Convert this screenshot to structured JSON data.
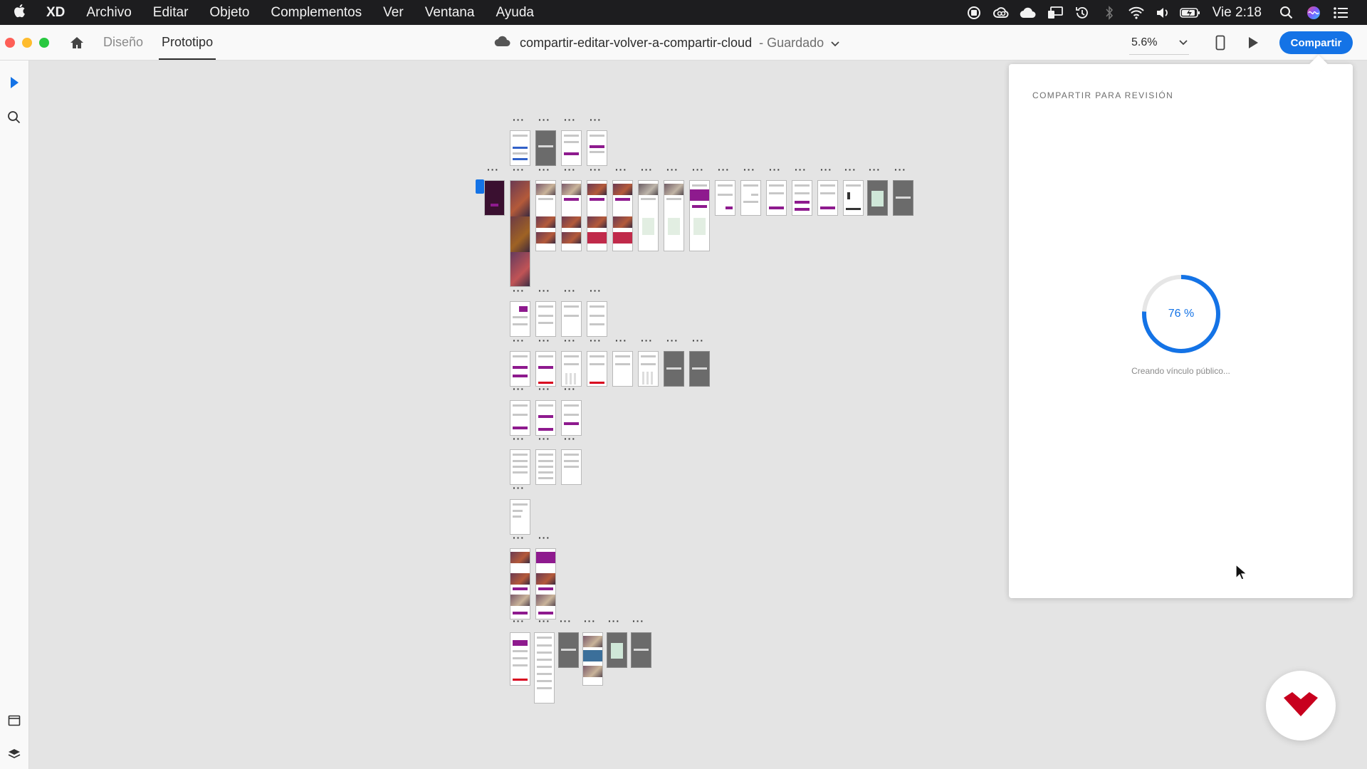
{
  "menubar": {
    "app": "XD",
    "items": [
      "Archivo",
      "Editar",
      "Objeto",
      "Complementos",
      "Ver",
      "Ventana",
      "Ayuda"
    ],
    "clock": "Vie 2:18",
    "status_icons": [
      "record-icon",
      "creative-cloud-icon",
      "icloud-icon",
      "display-icon",
      "time-machine-icon",
      "bluetooth-icon",
      "wifi-icon",
      "volume-icon",
      "battery-icon",
      "spotlight-icon",
      "siri-icon",
      "control-center-icon"
    ]
  },
  "toolbar": {
    "tabs": [
      "Diseño",
      "Prototipo"
    ],
    "active_tab": "Prototipo",
    "document_name": "compartir-editar-volver-a-compartir-cloud",
    "save_status": "- Guardado",
    "zoom": "5.6%",
    "share_label": "Compartir"
  },
  "share_panel": {
    "title": "COMPARTIR PARA REVISIÓN",
    "progress": 0.76,
    "progress_label": "76 %",
    "status_text": "Creando vínculo público..."
  },
  "colors": {
    "accent": "#1473e6",
    "brand_purple": "#8e1a8e",
    "logo_red": "#c8001e"
  }
}
